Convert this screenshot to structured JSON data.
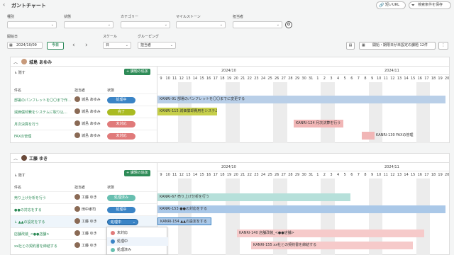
{
  "header": {
    "title": "ガントチャート",
    "share_url": "短いURL",
    "save_search": "検索条件を保存"
  },
  "filters": {
    "type_label": "種別",
    "status_label": "状態",
    "category_label": "カテゴリー",
    "milestone_label": "マイルストーン",
    "assignee_label": "担当者"
  },
  "controls": {
    "start_label": "開始日",
    "start_value": "2024/10/09",
    "today": "今日",
    "prev": "‹",
    "next": "›",
    "scale_label": "スケール",
    "scale_value": "日",
    "group_label": "グルーピング",
    "group_value": "担当者",
    "unset_button": "開始・期限日が未設定の課題 12件",
    "more": "⋮"
  },
  "months": [
    "2024/10",
    "2024/11"
  ],
  "days": [
    "9",
    "10",
    "11",
    "12",
    "13",
    "14",
    "15",
    "16",
    "17",
    "18",
    "19",
    "20",
    "21",
    "22",
    "23",
    "24",
    "25",
    "26",
    "27",
    "28",
    "29",
    "30",
    "31",
    "1",
    "2",
    "3",
    "4",
    "5",
    "6",
    "7",
    "8",
    "9",
    "10",
    "11",
    "12",
    "13",
    "14",
    "15",
    "16",
    "17",
    "18",
    "19",
    "20"
  ],
  "columns": {
    "name": "件名",
    "assignee": "担当者",
    "status": "状態"
  },
  "groups": [
    {
      "name": "城島 あゆみ",
      "collapse": "隠す",
      "add": "+ 課題の追加",
      "tasks": [
        {
          "name": "部署のパンフレットを〇〇まで作…",
          "assignee": "城島 あゆみ",
          "status": "処理中",
          "bar": "KANRI-91 部署のパンフレットを〇〇までに変更する"
        },
        {
          "name": "減価償却費をシステムに取り込…",
          "assignee": "城島 あゆみ",
          "status": "完了",
          "bar": "KANRI-115 減価償却費用をシステムに取り込む"
        },
        {
          "name": "月次決算を行う",
          "assignee": "城島 あゆみ",
          "status": "未対応",
          "bar": "KANRI-124 月次決算を行う"
        },
        {
          "name": "FAXの管理",
          "assignee": "城島 あゆみ",
          "status": "未対応",
          "bar": "KANRI-130 FAXの管理"
        }
      ]
    },
    {
      "name": "工藤 ゆき",
      "collapse": "隠す",
      "add": "+ 課題の追加",
      "tasks": [
        {
          "name": "売り上げ分析を行う",
          "assignee": "工藤 ゆき",
          "status": "処理済み",
          "bar": "KANRI-67 売り上げ分析を行う"
        },
        {
          "name": "●●の対応をする",
          "assignee": "田中孝司",
          "status": "処理中",
          "bar": "KANRI-153 ●●の対応をする"
        },
        {
          "name": "↳ ▲▲の設定をする",
          "assignee": "工藤 ゆき",
          "status": "処理中",
          "bar": "KANRI-154 ▲▲の設定をする"
        },
        {
          "name": "店舗改装_<●●店舗>",
          "assignee": "工藤 ゆき",
          "status": "",
          "bar": "KANRI-140 店舗改装_<●●店舗>"
        },
        {
          "name": "xx社との契約書を締結する",
          "assignee": "工藤 ゆき",
          "status": "",
          "bar": "KANRI-155 xx社との契約書を締結する"
        }
      ]
    }
  ],
  "dropdown": [
    {
      "label": "未対応",
      "color": "#e07a7a"
    },
    {
      "label": "処理中",
      "color": "#3a84c6"
    },
    {
      "label": "処理済み",
      "color": "#68bfb0"
    }
  ]
}
